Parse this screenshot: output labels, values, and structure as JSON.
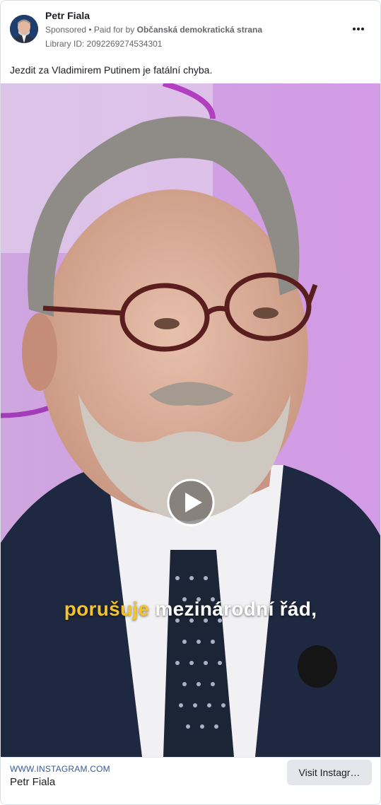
{
  "header": {
    "page_name": "Petr Fiala",
    "sponsored": "Sponsored",
    "separator": " • Paid for by ",
    "paid_by": "Občanská demokratická strana",
    "library_id": "Library ID: 2092269274534301",
    "more_icon": "more-horizontal-icon"
  },
  "post": {
    "caption": "Jezdit za Vladimirem Putinem je fatální chyba."
  },
  "video": {
    "subtitle_highlight": "porušuje",
    "subtitle_rest": " mezinárodní řád,",
    "play_icon": "play-icon",
    "highlight_color": "#f2c230"
  },
  "footer": {
    "domain": "WWW.INSTAGRAM.COM",
    "title": "Petr Fiala",
    "cta_label": "Visit Instagr…"
  }
}
